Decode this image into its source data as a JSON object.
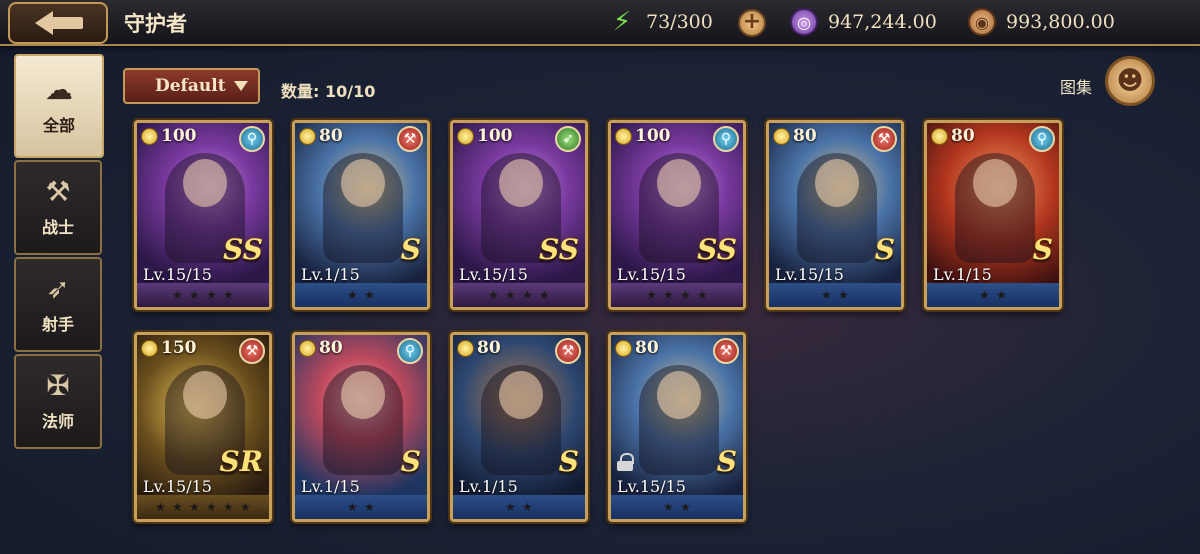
{
  "header": {
    "title": "守护者",
    "energy": "73/300",
    "gems": "947,244.00",
    "coins": "993,800.00"
  },
  "sidebar": {
    "items": [
      {
        "label": "全部",
        "icon": "cloud-icon",
        "active": true
      },
      {
        "label": "战士",
        "icon": "hammer-icon",
        "active": false
      },
      {
        "label": "射手",
        "icon": "bow-icon",
        "active": false
      },
      {
        "label": "法师",
        "icon": "staff-icon",
        "active": false
      }
    ]
  },
  "controls": {
    "sort_label": "Default",
    "count_label": "数量: 10/10",
    "collection_label": "图集"
  },
  "cards": [
    {
      "cost": "100",
      "class": "mage",
      "rarity": "SS",
      "level": "Lv.15/15",
      "stars": 4,
      "theme": "purple",
      "locked": false
    },
    {
      "cost": "80",
      "class": "warrior",
      "rarity": "S",
      "level": "Lv.1/15",
      "stars": 2,
      "theme": "blue",
      "locked": false
    },
    {
      "cost": "100",
      "class": "archer",
      "rarity": "SS",
      "level": "Lv.15/15",
      "stars": 4,
      "theme": "purple",
      "locked": false
    },
    {
      "cost": "100",
      "class": "mage",
      "rarity": "SS",
      "level": "Lv.15/15",
      "stars": 4,
      "theme": "purple",
      "locked": false
    },
    {
      "cost": "80",
      "class": "warrior",
      "rarity": "S",
      "level": "Lv.15/15",
      "stars": 2,
      "theme": "blue",
      "locked": false
    },
    {
      "cost": "80",
      "class": "mage",
      "rarity": "S",
      "level": "Lv.1/15",
      "stars": 2,
      "theme": "red",
      "locked": false
    },
    {
      "cost": "150",
      "class": "warrior",
      "rarity": "SR",
      "level": "Lv.15/15",
      "stars": 6,
      "theme": "gold",
      "locked": false
    },
    {
      "cost": "80",
      "class": "mage",
      "rarity": "S",
      "level": "Lv.1/15",
      "stars": 2,
      "theme": "pink",
      "locked": false
    },
    {
      "cost": "80",
      "class": "warrior",
      "rarity": "S",
      "level": "Lv.1/15",
      "stars": 2,
      "theme": "dusk",
      "locked": false
    },
    {
      "cost": "80",
      "class": "warrior",
      "rarity": "S",
      "level": "Lv.15/15",
      "stars": 2,
      "theme": "blue",
      "locked": true
    }
  ]
}
